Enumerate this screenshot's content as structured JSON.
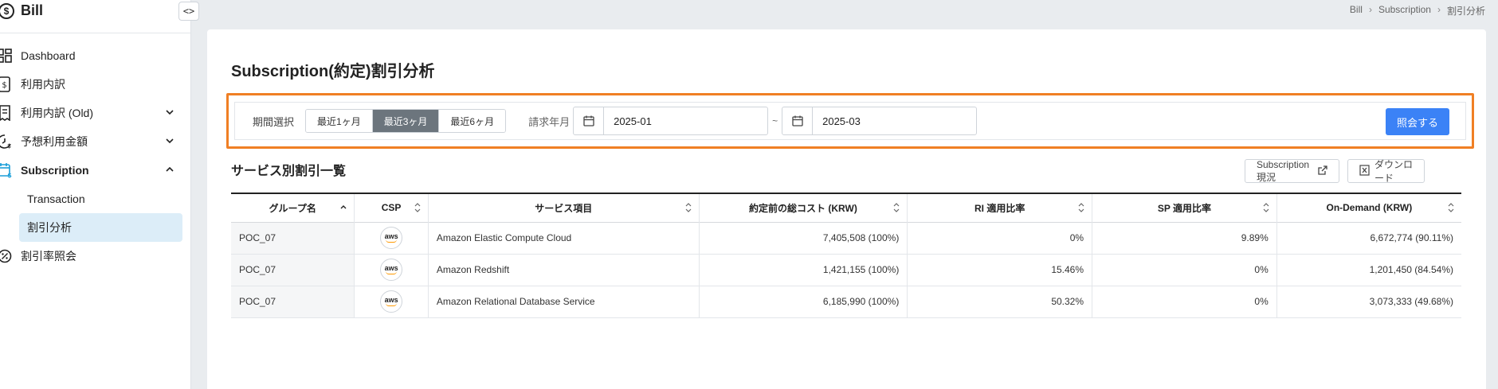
{
  "app": {
    "name": "Bill"
  },
  "sidebar": {
    "items": [
      {
        "label": "Dashboard"
      },
      {
        "label": "利用内訳"
      },
      {
        "label": "利用内訳 (Old)"
      },
      {
        "label": "予想利用金額"
      },
      {
        "label": "Subscription"
      },
      {
        "label": "Transaction"
      },
      {
        "label": "割引分析"
      },
      {
        "label": "割引率照会"
      }
    ]
  },
  "breadcrumb": [
    "Bill",
    "Subscription",
    "割引分析"
  ],
  "page": {
    "title": "Subscription(約定)割引分析"
  },
  "filter": {
    "label": "期間選択",
    "options": [
      "最近1ヶ月",
      "最近3ヶ月",
      "最近6ヶ月"
    ],
    "selected": "最近3ヶ月",
    "period_label": "請求年月",
    "start": "2025-01",
    "tilde": "~",
    "end": "2025-03",
    "query_label": "照会する"
  },
  "section": {
    "title": "サービス別割引一覧",
    "subscription_btn": "Subscription 現況",
    "download_btn": "ダウンロード"
  },
  "table": {
    "headers": [
      "グループ名",
      "CSP",
      "サービス項目",
      "約定前の総コスト (KRW)",
      "RI 適用比率",
      "SP 適用比率",
      "On-Demand (KRW)"
    ],
    "rows": [
      {
        "group": "POC_07",
        "csp": "aws",
        "service": "Amazon Elastic Compute Cloud",
        "total": "7,405,508 (100%)",
        "ri": "0%",
        "sp": "9.89%",
        "ondemand": "6,672,774 (90.11%)"
      },
      {
        "group": "POC_07",
        "csp": "aws",
        "service": "Amazon Redshift",
        "total": "1,421,155 (100%)",
        "ri": "15.46%",
        "sp": "0%",
        "ondemand": "1,201,450 (84.54%)"
      },
      {
        "group": "POC_07",
        "csp": "aws",
        "service": "Amazon Relational Database Service",
        "total": "6,185,990 (100%)",
        "ri": "50.32%",
        "sp": "0%",
        "ondemand": "3,073,333 (49.68%)"
      }
    ]
  },
  "colors": {
    "accent": "#3b82f6",
    "highlight": "#f07f24",
    "selected_nav": "#dcedf8",
    "active_icon": "#1a9ed8"
  }
}
